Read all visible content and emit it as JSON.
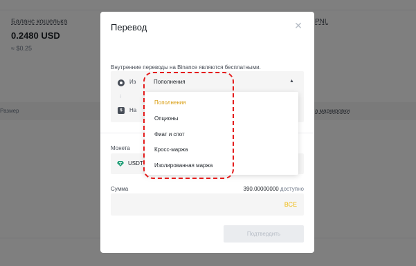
{
  "background": {
    "wallet_balance_label": "Баланс кошелька",
    "wallet_balance_value": "0.2480 USD",
    "wallet_balance_approx": "≈ $0.25",
    "pnl_label": "PNL",
    "col_size": "Размер",
    "col_mark": "а маркировки"
  },
  "modal": {
    "title": "Перевод",
    "close_icon": "close-icon",
    "note": "Внутренние переводы на Binance являются бесплатными.",
    "from_label": "Из",
    "from_value": "Пополнения",
    "to_label": "На",
    "coin_label": "Монета",
    "coin_value": "USDT",
    "amount_label": "Сумма",
    "available_amount": "390.00000000",
    "available_suffix": "доступно",
    "max_label": "ВСЕ",
    "confirm_label": "Подтвердить"
  },
  "dropdown": {
    "options": [
      "Пополнения",
      "Опционы",
      "Фиат и спот",
      "Кросс-маржа",
      "Изолированная маржа"
    ],
    "selected": "Пополнения"
  },
  "colors": {
    "accent": "#f0b90b",
    "selected_option": "#d89b0c",
    "highlight": "#e41b1b",
    "coin": "#26a17b"
  }
}
